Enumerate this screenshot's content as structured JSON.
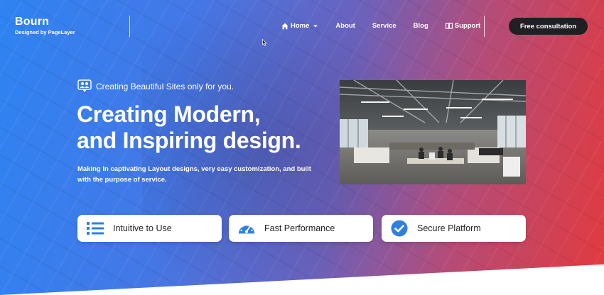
{
  "brand": {
    "name": "Bourn",
    "tagline": "Designed by PageLayer"
  },
  "nav": {
    "items": [
      {
        "label": "Home",
        "icon": "home-icon",
        "has_dropdown": true
      },
      {
        "label": "About"
      },
      {
        "label": "Service"
      },
      {
        "label": "Blog"
      },
      {
        "label": "Support",
        "icon": "book-icon"
      }
    ],
    "cta_label": "Free consultation"
  },
  "hero": {
    "eyebrow": "Creating Beautiful Sites only for you.",
    "headline_line1": "Creating Modern,",
    "headline_line2": "and Inspiring design.",
    "lead": "Making In captivating Layout designs, very easy customization, and built with the purpose of service."
  },
  "features": [
    {
      "label": "Intuitive to Use",
      "icon": "list-icon"
    },
    {
      "label": "Fast Performance",
      "icon": "speedometer-icon"
    },
    {
      "label": "Secure Platform",
      "icon": "check-circle-icon"
    }
  ],
  "colors": {
    "gradient_start": "#2f83f2",
    "gradient_end": "#e23a3e",
    "accent_blue": "#2f7fe0",
    "button_dark": "#1f1f24"
  }
}
